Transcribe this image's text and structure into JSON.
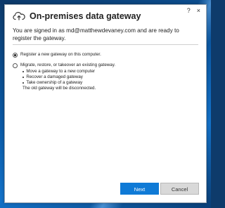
{
  "window": {
    "help_label": "?",
    "close_label": "×"
  },
  "header": {
    "title": "On-premises data gateway"
  },
  "intro": {
    "text": "You are signed in as md@matthewdevaney.com and are ready to register the gateway."
  },
  "options": [
    {
      "label": "Register a new gateway on this computer.",
      "selected": true
    },
    {
      "label": "Migrate, restore, or takeover an existing gateway.",
      "selected": false
    }
  ],
  "migrate_details": {
    "bullets": [
      "Move a gateway to a new computer",
      "Recover a damaged gateway",
      "Take ownership of a gateway"
    ],
    "note": "The old gateway will be disconnected."
  },
  "buttons": {
    "next": "Next",
    "cancel": "Cancel"
  }
}
